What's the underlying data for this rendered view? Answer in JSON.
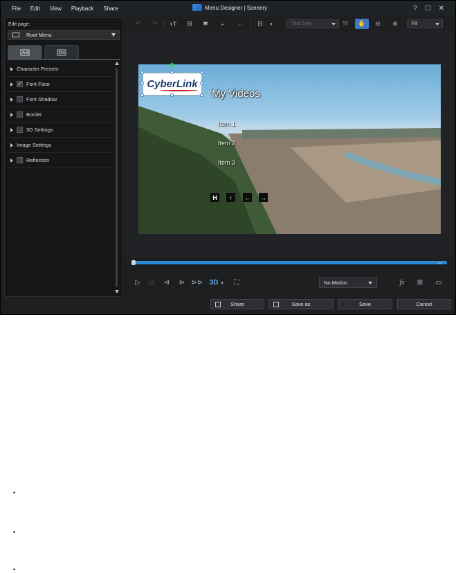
{
  "menu": [
    "File",
    "Edit",
    "View",
    "Playback",
    "Share"
  ],
  "window_title": "Menu Designer | Scenery",
  "window_controls": [
    "?",
    "☐",
    "✕"
  ],
  "left_panel": {
    "edit_page_label": "Edit page:",
    "page_value": "Root Menu",
    "properties": [
      {
        "label": "Character Presets",
        "checkbox": false,
        "checked": false
      },
      {
        "label": "Font Face",
        "checkbox": true,
        "checked": true
      },
      {
        "label": "Font Shadow",
        "checkbox": true,
        "checked": false
      },
      {
        "label": "Border",
        "checkbox": true,
        "checked": false
      },
      {
        "label": "3D Settings",
        "checkbox": true,
        "checked": false
      },
      {
        "label": "Image Settings",
        "checkbox": false,
        "checked": false
      },
      {
        "label": "Reflection",
        "checkbox": true,
        "checked": false
      }
    ]
  },
  "toolbar": {
    "text_mode": "Text Only",
    "zoom": "Fit"
  },
  "preview": {
    "logo_text": "CyberLink",
    "menu_title": "My Videos",
    "items": [
      "Item 1",
      "Item 2",
      "Item 3"
    ],
    "nav_buttons": [
      "H",
      "↑",
      "←",
      "→"
    ]
  },
  "playback": {
    "threed_label": "3D",
    "motion": "No Motion",
    "fx_label": "fx"
  },
  "buttons": {
    "share": "Share",
    "save_as": "Save as",
    "save": "Save",
    "cancel": "Cancel"
  },
  "bullets": [
    "•",
    "•",
    "•"
  ],
  "colors": {
    "accent": "#3a78c8",
    "timeline": "#2a8ad6",
    "background": "#1d1f21"
  }
}
